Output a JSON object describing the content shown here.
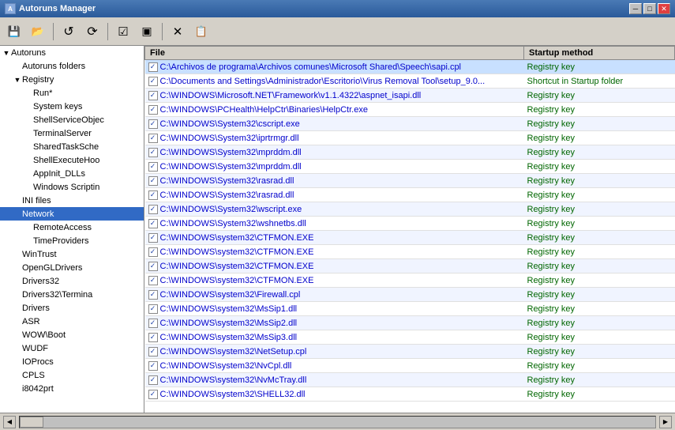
{
  "window": {
    "title": "Autoruns Manager"
  },
  "toolbar": {
    "buttons": [
      {
        "icon": "💾",
        "name": "save-button",
        "label": "Save"
      },
      {
        "icon": "📂",
        "name": "open-button",
        "label": "Open"
      },
      {
        "icon": "↺",
        "name": "refresh-button-1",
        "label": "Refresh"
      },
      {
        "icon": "🔃",
        "name": "refresh-button-2",
        "label": "Refresh All"
      },
      {
        "icon": "☑",
        "name": "check-button",
        "label": "Check"
      },
      {
        "icon": "▣",
        "name": "view-button",
        "label": "View"
      },
      {
        "icon": "✕",
        "name": "delete-button",
        "label": "Delete"
      },
      {
        "icon": "📋",
        "name": "copy-button",
        "label": "Copy"
      }
    ]
  },
  "tree": {
    "header": "Autoruns",
    "items": [
      {
        "id": "autoruns",
        "label": "Autoruns",
        "level": 0,
        "arrow": "▼",
        "selected": false
      },
      {
        "id": "autoruns-folders",
        "label": "Autoruns folders",
        "level": 1,
        "arrow": "",
        "selected": false
      },
      {
        "id": "registry",
        "label": "Registry",
        "level": 1,
        "arrow": "▼",
        "selected": false
      },
      {
        "id": "run-star",
        "label": "Run*",
        "level": 2,
        "arrow": "",
        "selected": false
      },
      {
        "id": "system-keys",
        "label": "System keys",
        "level": 2,
        "arrow": "",
        "selected": false
      },
      {
        "id": "shell-service",
        "label": "ShellServiceObjec",
        "level": 2,
        "arrow": "",
        "selected": false
      },
      {
        "id": "terminal-server",
        "label": "TerminalServer",
        "level": 2,
        "arrow": "",
        "selected": false
      },
      {
        "id": "shared-task",
        "label": "SharedTaskSche",
        "level": 2,
        "arrow": "",
        "selected": false
      },
      {
        "id": "shell-execute",
        "label": "ShellExecuteHoo",
        "level": 2,
        "arrow": "",
        "selected": false
      },
      {
        "id": "appinit",
        "label": "AppInit_DLLs",
        "level": 2,
        "arrow": "",
        "selected": false
      },
      {
        "id": "windows-scripting",
        "label": "Windows Scriptin",
        "level": 2,
        "arrow": "",
        "selected": false
      },
      {
        "id": "ini-files",
        "label": "INI files",
        "level": 1,
        "arrow": "",
        "selected": false
      },
      {
        "id": "network",
        "label": "Network",
        "level": 1,
        "arrow": "",
        "selected": true
      },
      {
        "id": "remote-access",
        "label": "RemoteAccess",
        "level": 2,
        "arrow": "",
        "selected": false
      },
      {
        "id": "time-providers",
        "label": "TimeProviders",
        "level": 2,
        "arrow": "",
        "selected": false
      },
      {
        "id": "wintrust",
        "label": "WinTrust",
        "level": 1,
        "arrow": "",
        "selected": false
      },
      {
        "id": "opengl",
        "label": "OpenGLDrivers",
        "level": 1,
        "arrow": "",
        "selected": false
      },
      {
        "id": "drivers32",
        "label": "Drivers32",
        "level": 1,
        "arrow": "",
        "selected": false
      },
      {
        "id": "drivers32-term",
        "label": "Drivers32\\Termina",
        "level": 1,
        "arrow": "",
        "selected": false
      },
      {
        "id": "drivers",
        "label": "Drivers",
        "level": 1,
        "arrow": "",
        "selected": false
      },
      {
        "id": "asr",
        "label": "ASR",
        "level": 1,
        "arrow": "",
        "selected": false
      },
      {
        "id": "wow-boot",
        "label": "WOW\\Boot",
        "level": 1,
        "arrow": "",
        "selected": false
      },
      {
        "id": "wudf",
        "label": "WUDF",
        "level": 1,
        "arrow": "",
        "selected": false
      },
      {
        "id": "ioprocs",
        "label": "IOProcs",
        "level": 1,
        "arrow": "",
        "selected": false
      },
      {
        "id": "cpls",
        "label": "CPLS",
        "level": 1,
        "arrow": "",
        "selected": false
      },
      {
        "id": "i8042prt",
        "label": "i8042prt",
        "level": 1,
        "arrow": "",
        "selected": false
      }
    ]
  },
  "table": {
    "columns": [
      {
        "id": "file",
        "label": "File"
      },
      {
        "id": "startup",
        "label": "Startup method"
      }
    ],
    "rows": [
      {
        "checked": true,
        "path": "C:\\Archivos de programa\\Archivos comunes\\Microsoft Shared\\Speech\\sapi.cpl",
        "method": "Registry key",
        "highlight": true
      },
      {
        "checked": true,
        "path": "C:\\Documents and Settings\\Administrador\\Escritorio\\Virus Removal Tool\\setup_9.0...",
        "method": "Shortcut in Startup folder",
        "highlight": false
      },
      {
        "checked": true,
        "path": "C:\\WINDOWS\\Microsoft.NET\\Framework\\v1.1.4322\\aspnet_isapi.dll",
        "method": "Registry key",
        "highlight": false
      },
      {
        "checked": true,
        "path": "C:\\WINDOWS\\PCHealth\\HelpCtr\\Binaries\\HelpCtr.exe",
        "method": "Registry key",
        "highlight": false
      },
      {
        "checked": true,
        "path": "C:\\WINDOWS\\System32\\cscript.exe",
        "method": "Registry key",
        "highlight": false
      },
      {
        "checked": true,
        "path": "C:\\WINDOWS\\System32\\iprtrmgr.dll",
        "method": "Registry key",
        "highlight": false
      },
      {
        "checked": true,
        "path": "C:\\WINDOWS\\System32\\mprddm.dll",
        "method": "Registry key",
        "highlight": false
      },
      {
        "checked": true,
        "path": "C:\\WINDOWS\\System32\\mprddm.dll",
        "method": "Registry key",
        "highlight": false
      },
      {
        "checked": true,
        "path": "C:\\WINDOWS\\System32\\rasrad.dll",
        "method": "Registry key",
        "highlight": false
      },
      {
        "checked": true,
        "path": "C:\\WINDOWS\\System32\\rasrad.dll",
        "method": "Registry key",
        "highlight": false
      },
      {
        "checked": true,
        "path": "C:\\WINDOWS\\System32\\wscript.exe",
        "method": "Registry key",
        "highlight": false
      },
      {
        "checked": true,
        "path": "C:\\WINDOWS\\System32\\wshnetbs.dll",
        "method": "Registry key",
        "highlight": false
      },
      {
        "checked": true,
        "path": "C:\\WINDOWS\\system32\\CTFMON.EXE",
        "method": "Registry key",
        "highlight": false
      },
      {
        "checked": true,
        "path": "C:\\WINDOWS\\system32\\CTFMON.EXE",
        "method": "Registry key",
        "highlight": false
      },
      {
        "checked": true,
        "path": "C:\\WINDOWS\\system32\\CTFMON.EXE",
        "method": "Registry key",
        "highlight": false
      },
      {
        "checked": true,
        "path": "C:\\WINDOWS\\system32\\CTFMON.EXE",
        "method": "Registry key",
        "highlight": false
      },
      {
        "checked": true,
        "path": "C:\\WINDOWS\\system32\\Firewall.cpl",
        "method": "Registry key",
        "highlight": false
      },
      {
        "checked": true,
        "path": "C:\\WINDOWS\\system32\\MsSip1.dll",
        "method": "Registry key",
        "highlight": false
      },
      {
        "checked": true,
        "path": "C:\\WINDOWS\\system32\\MsSip2.dll",
        "method": "Registry key",
        "highlight": false
      },
      {
        "checked": true,
        "path": "C:\\WINDOWS\\system32\\MsSip3.dll",
        "method": "Registry key",
        "highlight": false
      },
      {
        "checked": true,
        "path": "C:\\WINDOWS\\system32\\NetSetup.cpl",
        "method": "Registry key",
        "highlight": false
      },
      {
        "checked": true,
        "path": "C:\\WINDOWS\\system32\\NvCpl.dll",
        "method": "Registry key",
        "highlight": false
      },
      {
        "checked": true,
        "path": "C:\\WINDOWS\\system32\\NvMcTray.dll",
        "method": "Registry key",
        "highlight": false
      },
      {
        "checked": true,
        "path": "C:\\WINDOWS\\system32\\SHELL32.dll",
        "method": "Registry key",
        "highlight": false
      }
    ]
  },
  "title_controls": {
    "minimize": "─",
    "maximize": "□",
    "close": "✕"
  }
}
